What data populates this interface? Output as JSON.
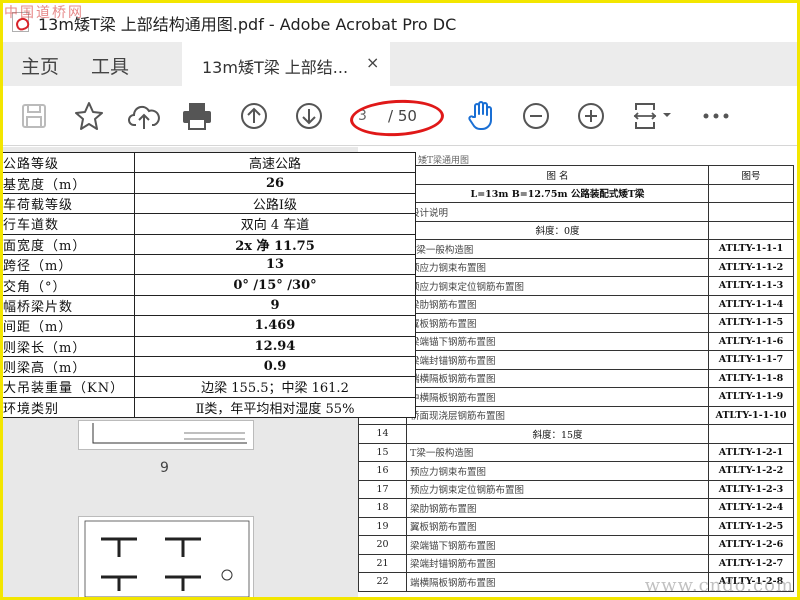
{
  "watermark_top": "中国道桥网",
  "watermark_bottom": "www.cndo.com",
  "window": {
    "title": "13m矮T梁 上部结构通用图.pdf - Adobe Acrobat Pro DC"
  },
  "menu": {
    "home": "主页",
    "tools": "工具"
  },
  "tab": {
    "label": "13m矮T梁 上部结...",
    "close": "×"
  },
  "toolbar": {
    "icons": [
      "save-icon",
      "star-icon",
      "upload-icon",
      "print-icon",
      "arrow-up-icon",
      "arrow-down-icon",
      "hand-icon",
      "zoom-out-icon",
      "zoom-in-icon",
      "page-fit-icon",
      "more-icon"
    ],
    "page_current": "3",
    "page_total": "/ 50"
  },
  "thumbnail": {
    "page_label": "9"
  },
  "spec_table": [
    {
      "label": "公路等级",
      "value": "高速公路"
    },
    {
      "label": "基宽度（m）",
      "value": "26"
    },
    {
      "label": "车荷载等级",
      "value": "公路Ⅰ级"
    },
    {
      "label": "行车道数",
      "value": "双向 4 车道"
    },
    {
      "label": "面宽度（m）",
      "value": "2x 净 11.75"
    },
    {
      "label": "跨径（m）",
      "value": "13"
    },
    {
      "label": "交角（°）",
      "value": "0° /15° /30°"
    },
    {
      "label": "幅桥梁片数",
      "value": "9"
    },
    {
      "label": "间距（m）",
      "value": "1.469"
    },
    {
      "label": "则梁长（m）",
      "value": "12.94"
    },
    {
      "label": "则梁高（m）",
      "value": "0.9"
    },
    {
      "label": "大吊装重量（KN）",
      "value": "边梁 155.5；中梁 161.2"
    },
    {
      "label": "环境类别",
      "value": "Ⅱ类，年平均相对湿度 55%"
    }
  ],
  "index_page": {
    "header": "矮T梁通用图",
    "col_name": "图  名",
    "col_code": "图号",
    "subtitle": "L=13m B=12.75m 公路装配式矮T梁",
    "rows": [
      {
        "n": "",
        "name": "设计说明",
        "code": ""
      },
      {
        "n": "",
        "name": "斜度：0度",
        "code": "",
        "section": true
      },
      {
        "n": "",
        "name": "T梁一般构造图",
        "code": "ATLTY-1-1-1"
      },
      {
        "n": "",
        "name": "预应力钢束布置图",
        "code": "ATLTY-1-1-2"
      },
      {
        "n": "",
        "name": "预应力钢束定位钢筋布置图",
        "code": "ATLTY-1-1-3"
      },
      {
        "n": "",
        "name": "梁肋钢筋布置图",
        "code": "ATLTY-1-1-4"
      },
      {
        "n": "",
        "name": "翼板钢筋布置图",
        "code": "ATLTY-1-1-5"
      },
      {
        "n": "",
        "name": "梁端锚下钢筋布置图",
        "code": "ATLTY-1-1-6"
      },
      {
        "n": "",
        "name": "梁端封锚钢筋布置图",
        "code": "ATLTY-1-1-7"
      },
      {
        "n": "",
        "name": "端横隔板钢筋布置图",
        "code": "ATLTY-1-1-8"
      },
      {
        "n": "",
        "name": "中横隔板钢筋布置图",
        "code": "ATLTY-1-1-9"
      },
      {
        "n": "",
        "name": "桥面现浇层钢筋布置图",
        "code": "ATLTY-1-1-10"
      },
      {
        "n": "14",
        "name": "斜度：15度",
        "code": "",
        "section": true
      },
      {
        "n": "15",
        "name": "T梁一般构造图",
        "code": "ATLTY-1-2-1"
      },
      {
        "n": "16",
        "name": "预应力钢束布置图",
        "code": "ATLTY-1-2-2"
      },
      {
        "n": "17",
        "name": "预应力钢束定位钢筋布置图",
        "code": "ATLTY-1-2-3"
      },
      {
        "n": "18",
        "name": "梁肋钢筋布置图",
        "code": "ATLTY-1-2-4"
      },
      {
        "n": "19",
        "name": "翼板钢筋布置图",
        "code": "ATLTY-1-2-5"
      },
      {
        "n": "20",
        "name": "梁端锚下钢筋布置图",
        "code": "ATLTY-1-2-6"
      },
      {
        "n": "21",
        "name": "梁端封锚钢筋布置图",
        "code": "ATLTY-1-2-7"
      },
      {
        "n": "22",
        "name": "端横隔板钢筋布置图",
        "code": "ATLTY-1-2-8"
      }
    ]
  },
  "colors": {
    "frame": "#f3e600",
    "highlight": "#e01818",
    "tabbar": "#ececec"
  }
}
